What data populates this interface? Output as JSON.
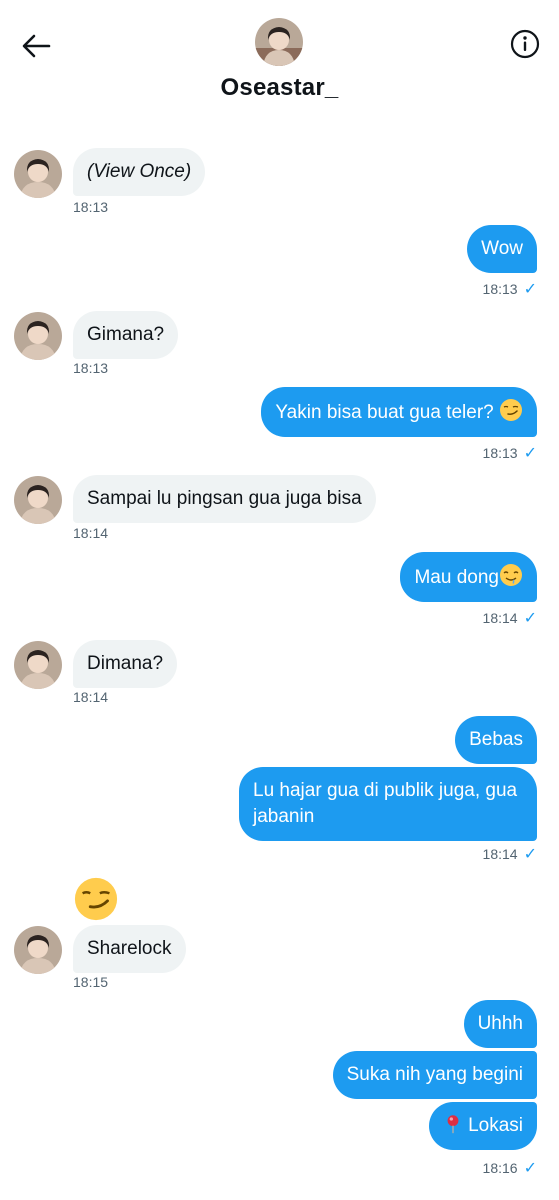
{
  "header": {
    "name": "Oseastar_",
    "back_icon": "arrow-left-icon",
    "info_icon": "info-icon"
  },
  "messages": [
    {
      "side": "recv",
      "text": "(View Once)",
      "time": "18:13"
    },
    {
      "side": "sent",
      "text": "Wow",
      "time": "18:13"
    },
    {
      "side": "recv",
      "text": "Gimana?",
      "time": "18:13"
    },
    {
      "side": "sent",
      "text": "Yakin bisa buat gua teler?",
      "emoji": "smirk",
      "time": "18:13"
    },
    {
      "side": "recv",
      "text": "Sampai lu pingsan gua juga bisa",
      "time": "18:14"
    },
    {
      "side": "sent",
      "text": "Mau dong",
      "emoji": "drool",
      "time": "18:14"
    },
    {
      "side": "recv",
      "text": "Dimana?",
      "time": "18:14"
    },
    {
      "side": "sent",
      "text": "Bebas"
    },
    {
      "side": "sent",
      "text": "Lu hajar gua di publik juga, gua jabanin",
      "time": "18:14"
    },
    {
      "side": "recv",
      "emoji": "smirk"
    },
    {
      "side": "recv",
      "text": "Sharelock",
      "time": "18:15"
    },
    {
      "side": "sent",
      "text": "Uhhh"
    },
    {
      "side": "sent",
      "text": "Suka nih yang begini"
    },
    {
      "side": "sent",
      "emoji": "pin",
      "text": "Lokasi",
      "time": "18:16"
    }
  ],
  "colors": {
    "sent_bubble": "#1d9bf0",
    "recv_bubble": "#eff3f4",
    "timestamp": "#536471"
  }
}
